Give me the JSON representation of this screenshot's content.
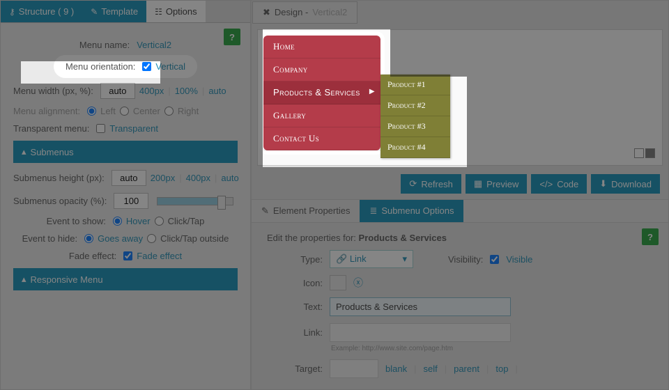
{
  "tabs": {
    "structure": "Structure ( 9 )",
    "template": "Template",
    "options": "Options"
  },
  "menu": {
    "name_label": "Menu name:",
    "name_value": "Vertical2",
    "orient_label": "Menu orientation:",
    "orient_value": "Vertical",
    "width_label": "Menu width (px, %):",
    "width_value": "auto",
    "w1": "400px",
    "w2": "100%",
    "w3": "auto",
    "align_label": "Menu alignment:",
    "a1": "Left",
    "a2": "Center",
    "a3": "Right",
    "trans_label": "Transparent menu:",
    "trans_value": "Transparent"
  },
  "submenus": {
    "title": "Submenus",
    "h_label": "Submenus height (px):",
    "h_value": "auto",
    "h1": "200px",
    "h2": "400px",
    "h3": "auto",
    "op_label": "Submenus opacity (%):",
    "op_value": "100",
    "show_label": "Event to show:",
    "show1": "Hover",
    "show2": "Click/Tap",
    "hide_label": "Event to hide:",
    "hide1": "Goes away",
    "hide2": "Click/Tap outside",
    "fade_label": "Fade effect:",
    "fade_value": "Fade effect"
  },
  "responsive": {
    "title": "Responsive Menu"
  },
  "design": {
    "title": "Design -",
    "name": "Vertical2",
    "items": [
      "Home",
      "Company",
      "Products & Services",
      "Gallery",
      "Contact Us"
    ],
    "sub": [
      "Product #1",
      "Product #2",
      "Product #3",
      "Product #4"
    ]
  },
  "buttons": {
    "refresh": "Refresh",
    "preview": "Preview",
    "code": "Code",
    "download": "Download"
  },
  "subtabs": {
    "elem": "Element Properties",
    "sub": "Submenu Options"
  },
  "props": {
    "intro": "Edit the properties for:",
    "for": "Products & Services",
    "type_label": "Type:",
    "type_value": "Link",
    "vis_label": "Visibility:",
    "vis_value": "Visible",
    "icon_label": "Icon:",
    "text_label": "Text:",
    "text_value": "Products & Services",
    "link_label": "Link:",
    "link_hint": "Example: http://www.site.com/page.htm",
    "target_label": "Target:",
    "t1": "blank",
    "t2": "self",
    "t3": "parent",
    "t4": "top"
  }
}
